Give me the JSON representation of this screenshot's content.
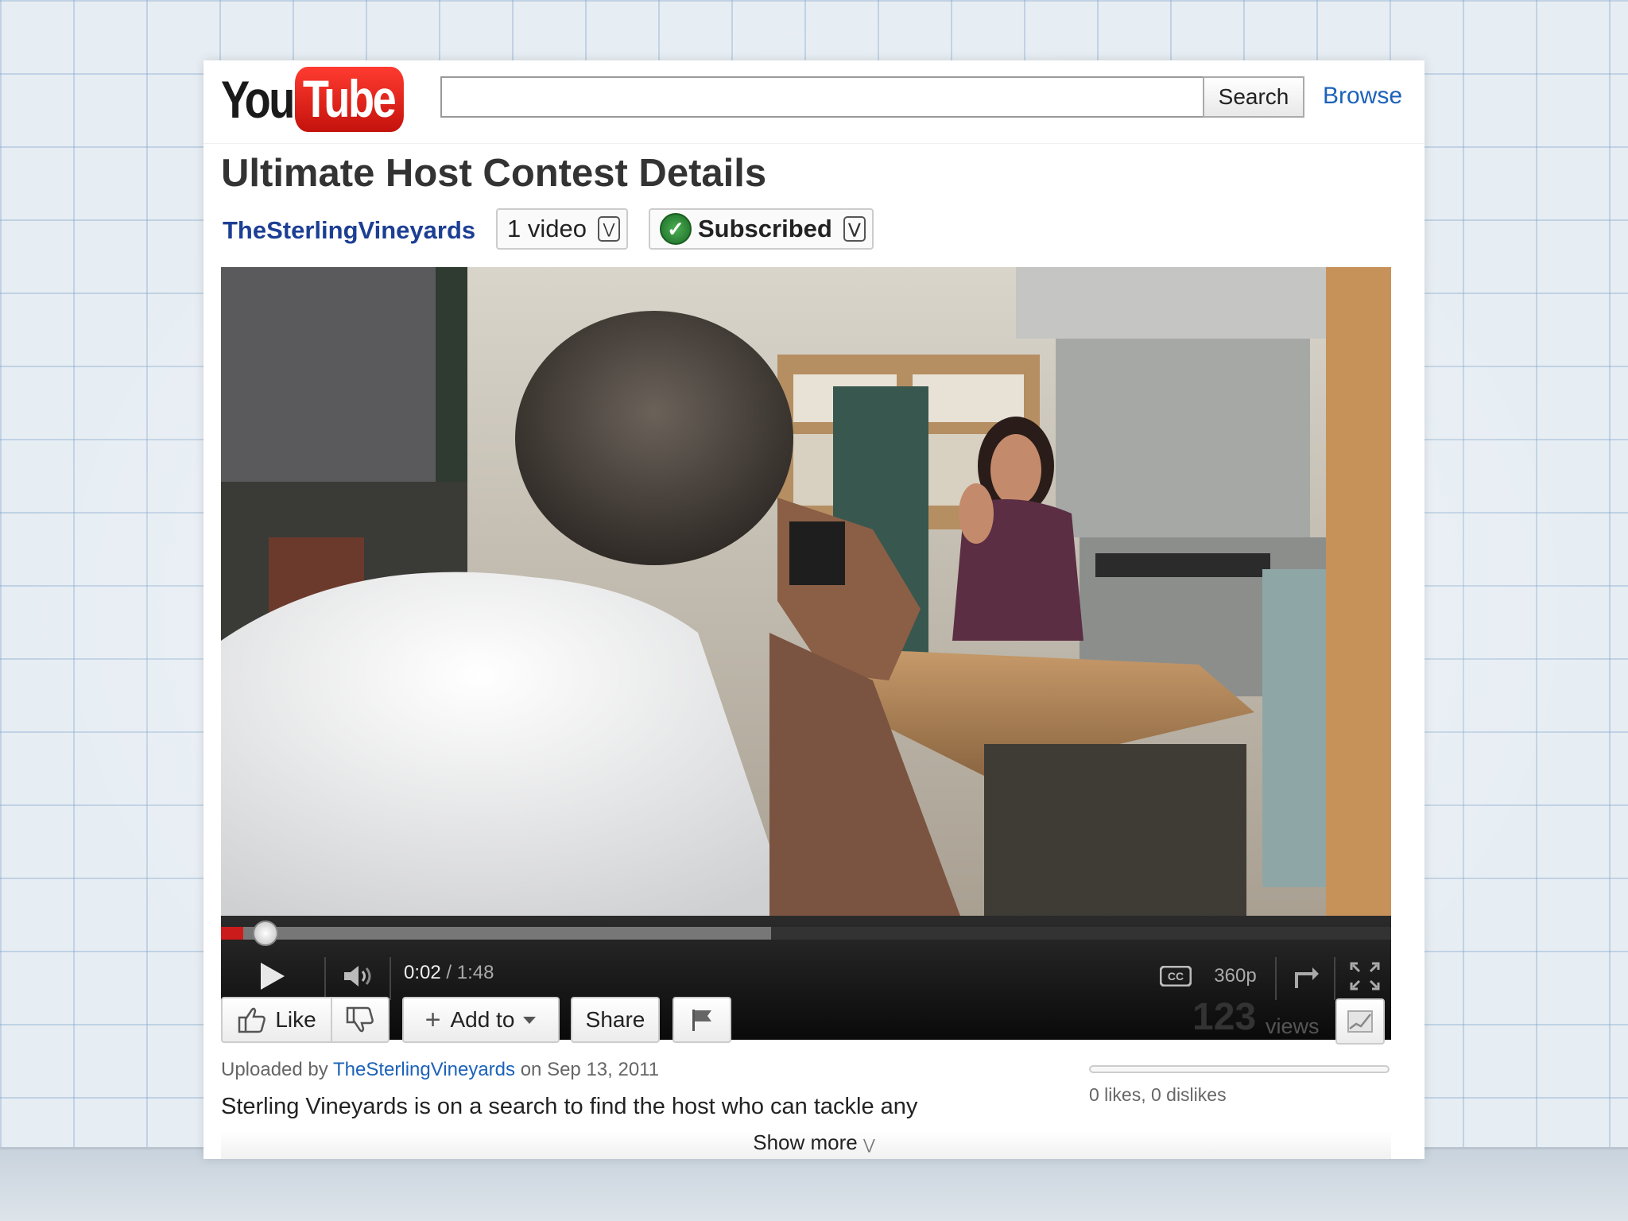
{
  "header": {
    "logo_you": "You",
    "logo_tube": "Tube",
    "search_placeholder": "",
    "search_label": "Search",
    "browse_label": "Browse"
  },
  "video_title": "Ultimate Host Contest Details",
  "channel": {
    "name": "TheSterlingVineyards",
    "video_count": "1 video",
    "subscribed_label": "Subscribed"
  },
  "player": {
    "current_time": "0:02",
    "separator": " / ",
    "duration": "1:48",
    "quality": "360p",
    "progress_fraction": 0.019,
    "buffered_fraction": 0.47
  },
  "actions": {
    "like_label": "Like",
    "add_to_label": "Add to",
    "share_label": "Share"
  },
  "stats": {
    "views_count": "123",
    "views_label": "views",
    "likes_text": "0 likes, 0 dislikes"
  },
  "upload": {
    "prefix": "Uploaded by",
    "uploader": "TheSterlingVineyards",
    "date_text": "on Sep 13, 2011"
  },
  "description": "Sterling Vineyards is on a search to find the host who can tackle any",
  "show_more_label": "Show more",
  "colors": {
    "brand_red": "#cc1b1b",
    "link_blue": "#1c62b9",
    "channel_blue": "#1c3f94",
    "subscribed_green": "#2e7d32"
  }
}
